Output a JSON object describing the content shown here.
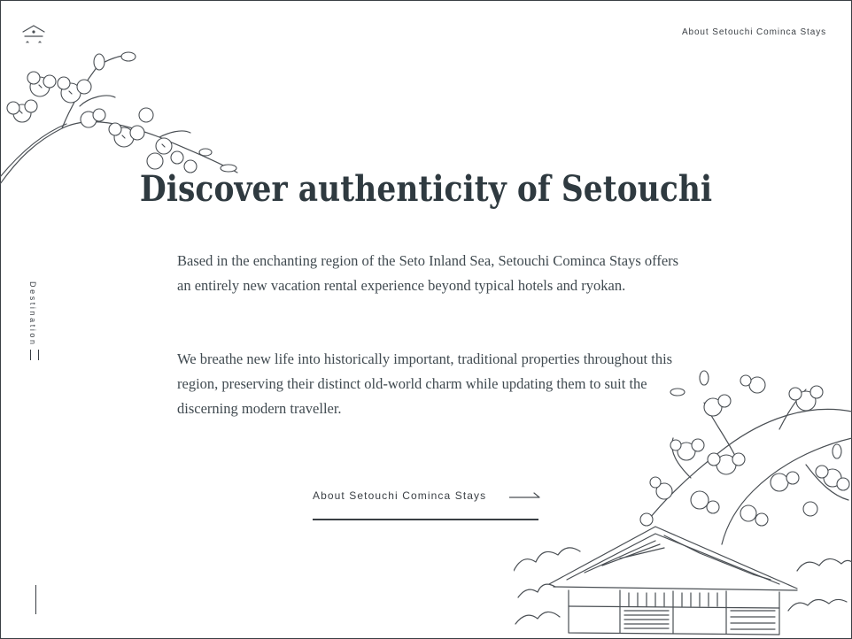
{
  "header": {
    "logo_icon": "house-roof-logo-icon",
    "top_link_label": "About Setouchi Cominca Stays"
  },
  "sidebar": {
    "vertical_label": "Destination",
    "page_number": "1"
  },
  "main": {
    "heading": "Discover authenticity of Setouchi",
    "paragraphs": [
      "Based in the enchanting region of the Seto Inland Sea, Setouchi Cominca Stays offers an entirely new vacation rental experience beyond typical hotels and ryokan.",
      "We breathe new life into historically important, traditional properties throughout this region, preserving their distinct old-world charm while updating them to suit the discerning modern traveller."
    ],
    "cta_label": "About Setouchi Cominca Stays",
    "cta_icon": "arrow-right-icon"
  },
  "colors": {
    "text": "#3a3f44",
    "heading": "#2f3a40",
    "background": "#ffffff"
  }
}
